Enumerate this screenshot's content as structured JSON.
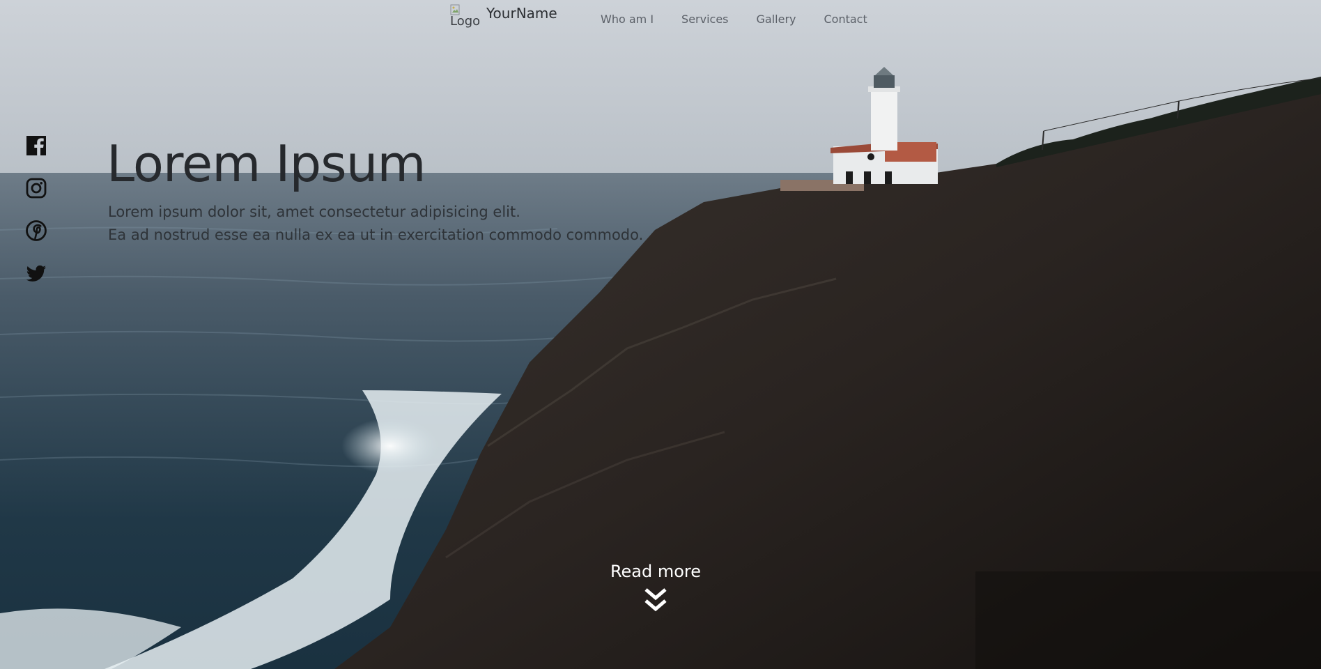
{
  "brand": {
    "logo_alt": "Logo",
    "name": "YourName"
  },
  "nav": {
    "links": [
      {
        "label": "Who am I"
      },
      {
        "label": "Services"
      },
      {
        "label": "Gallery"
      },
      {
        "label": "Contact"
      }
    ]
  },
  "social": {
    "icons": [
      "facebook-icon",
      "instagram-icon",
      "pinterest-icon",
      "twitter-icon"
    ]
  },
  "hero": {
    "title": "Lorem Ipsum",
    "subtitle_lines": [
      "Lorem ipsum dolor sit, amet consectetur adipisicing elit.",
      "Ea ad nostrud esse ea nulla ex ea ut in exercitation commodo commodo."
    ],
    "cta_label": "Read more",
    "cta_icon": "double-chevron-down-icon"
  },
  "colors": {
    "sky": "#c5cbd1",
    "sea": "#3c4f5f",
    "cliff": "#2a2522",
    "text_dark": "#26292d",
    "nav_text": "#5b6068",
    "cta_text": "#ffffff"
  }
}
